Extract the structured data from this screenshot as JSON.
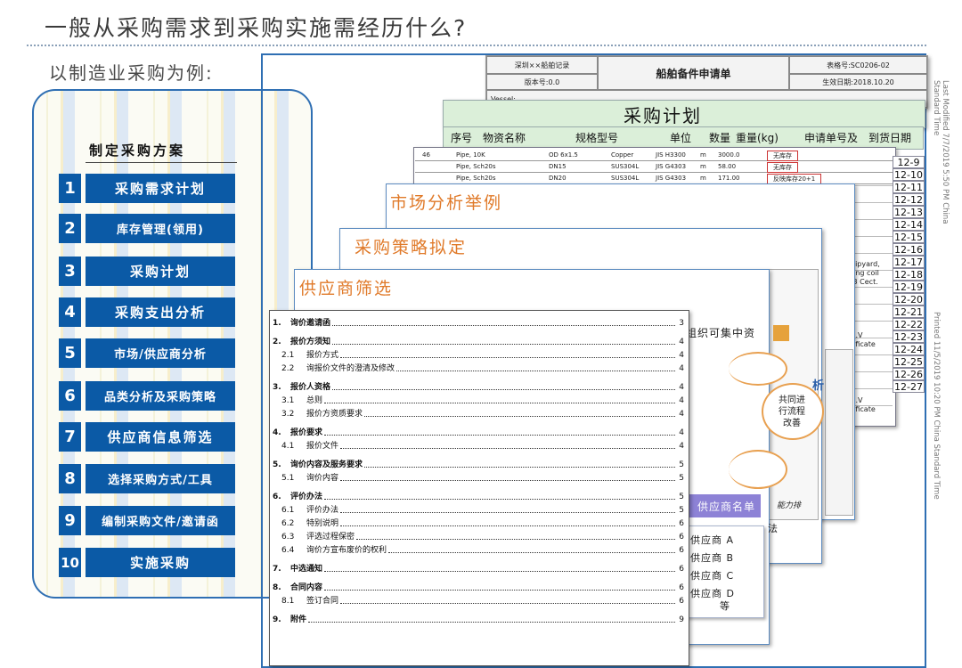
{
  "header": {
    "title": "一般从采购需求到采购实施需经历什么?",
    "subtitle": "以制造业采购为例:"
  },
  "plan": {
    "title": "制定采购方案",
    "steps": [
      {
        "num": "1",
        "label": "采购需求计划"
      },
      {
        "num": "2",
        "label": "库存管理(领用)"
      },
      {
        "num": "3",
        "label": "采购计划"
      },
      {
        "num": "4",
        "label": "采购支出分析"
      },
      {
        "num": "5",
        "label": "市场/供应商分析"
      },
      {
        "num": "6",
        "label": "品类分析及采购策略"
      },
      {
        "num": "7",
        "label": "供应商信息筛选"
      },
      {
        "num": "8",
        "label": "选择采购方式/工具"
      },
      {
        "num": "9",
        "label": "编制采购文件/邀请函"
      },
      {
        "num": "10",
        "label": "实施采购"
      }
    ]
  },
  "sheets": {
    "form": {
      "company": "深圳××船舶记录",
      "title": "船舶备件申请单",
      "version": "版本号:0.0",
      "form_no": "表格号:SC0206-02",
      "date": "生效日期:2018.10.20",
      "vessel": "Vessel:"
    },
    "purchase_plan": {
      "title": "采购计划",
      "columns": [
        "序号",
        "物资名称",
        "规格型号",
        "单位",
        "数量",
        "重量(kg)",
        "申请单号及",
        "到货日期"
      ]
    },
    "table_rows": [
      {
        "no": "46",
        "name": "Pipe, 10K",
        "spec": "OD 6x1.5",
        "mat": "Copper",
        "code": "JIS H3300",
        "unit": "m",
        "qty": "3000.0",
        "note": "无库存"
      },
      {
        "no": "",
        "name": "Pipe, Sch20s",
        "spec": "DN15",
        "mat": "SUS304L",
        "code": "JIS G4303",
        "unit": "m",
        "qty": "58.00",
        "note": "无库存"
      },
      {
        "no": "",
        "name": "Pipe, Sch20s",
        "spec": "DN20",
        "mat": "SUS304L",
        "code": "JIS G4303",
        "unit": "m",
        "qty": "171.00",
        "note": "反映库存20+1"
      }
    ],
    "dates": [
      "12-9",
      "12-10",
      "12-11",
      "12-12",
      "12-13",
      "12-14",
      "12-15",
      "12-16",
      "12-17",
      "12-18",
      "12-19",
      "12-20",
      "12-21",
      "12-22",
      "12-23",
      "12-24",
      "12-25",
      "12-26",
      "12-27"
    ],
    "market_title": "市场分析举例",
    "strategy_title": "采购策略拟定",
    "supplier_title": "供应商筛选",
    "fragments": {
      "concentrate": "组织可集中资",
      "coop1": "共同进",
      "coop2": "行流程",
      "coop3": "改善",
      "analysis": "析",
      "shipyard1": "hipyard,",
      "shipyard2": "ting coil",
      "shipyard3": ".3 Cect.",
      "cert1": "B.V",
      "cert2": "tificate",
      "cert3": "B.V",
      "cert4": "tificate",
      "ability": "能力排",
      "method": "法",
      "list_title": "供应商名单",
      "etc": "等"
    },
    "suppliers": [
      "供应商 A",
      "供应商 B",
      "供应商 C",
      "供应商 D"
    ],
    "side_notes": [
      "Last Modified 7/7/2019 5:50 PM China Standard Time",
      "Printed 11/5/2019 10:20 PM China Standard Time"
    ]
  },
  "toc": [
    {
      "num": "1.",
      "text": "询价邀请函",
      "page": "3",
      "sub": false
    },
    {
      "num": "2.",
      "text": "报价方须知",
      "page": "4",
      "sub": false
    },
    {
      "num": "2.1",
      "text": "报价方式",
      "page": "4",
      "sub": true
    },
    {
      "num": "2.2",
      "text": "询报价文件的澄清及修改",
      "page": "4",
      "sub": true
    },
    {
      "num": "3.",
      "text": "报价人资格",
      "page": "4",
      "sub": false
    },
    {
      "num": "3.1",
      "text": "总则",
      "page": "4",
      "sub": true
    },
    {
      "num": "3.2",
      "text": "报价方资质要求",
      "page": "4",
      "sub": true
    },
    {
      "num": "4.",
      "text": "报价要求",
      "page": "4",
      "sub": false
    },
    {
      "num": "4.1",
      "text": "报价文件",
      "page": "4",
      "sub": true
    },
    {
      "num": "5.",
      "text": "询价内容及服务要求",
      "page": "5",
      "sub": false
    },
    {
      "num": "5.1",
      "text": "询价内容",
      "page": "5",
      "sub": true
    },
    {
      "num": "6.",
      "text": "评价办法",
      "page": "5",
      "sub": false
    },
    {
      "num": "6.1",
      "text": "评价办法",
      "page": "5",
      "sub": true
    },
    {
      "num": "6.2",
      "text": "特别说明",
      "page": "6",
      "sub": true
    },
    {
      "num": "6.3",
      "text": "评选过程保密",
      "page": "6",
      "sub": true
    },
    {
      "num": "6.4",
      "text": "询价方宣布废价的权利",
      "page": "6",
      "sub": true
    },
    {
      "num": "7.",
      "text": "中选通知",
      "page": "6",
      "sub": false
    },
    {
      "num": "8.",
      "text": "合同内容",
      "page": "6",
      "sub": false
    },
    {
      "num": "8.1",
      "text": "签订合同",
      "page": "6",
      "sub": true
    },
    {
      "num": "9.",
      "text": "附件",
      "page": "9",
      "sub": false
    }
  ]
}
